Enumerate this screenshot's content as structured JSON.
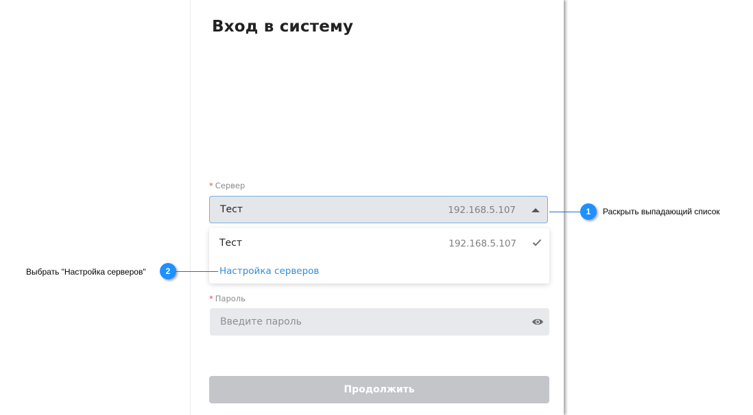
{
  "login": {
    "title": "Вход в систему",
    "server_label": "Сервер",
    "password_label": "Пароль",
    "required_mark": "*",
    "selected_server": {
      "name": "Тест",
      "ip": "192.168.5.107"
    },
    "dropdown": {
      "options": [
        {
          "name": "Тест",
          "ip": "192.168.5.107",
          "selected": true
        }
      ],
      "settings_link": "Настройка серверов"
    },
    "password_placeholder": "Введите пароль",
    "continue_button": "Продолжить"
  },
  "callouts": [
    {
      "number": "1",
      "text": "Раскрыть выпадающий список"
    },
    {
      "number": "2",
      "text": "Выбрать \"Настройка серверов\""
    }
  ],
  "colors": {
    "accent": "#2f8de4",
    "badge": "#1e90ff",
    "required": "#e5484d",
    "disabled_button": "#c4c5c9"
  },
  "icons": {
    "select_caret": "caret-up-icon",
    "selected_option": "checkmark-icon",
    "password_toggle": "eye-icon"
  }
}
